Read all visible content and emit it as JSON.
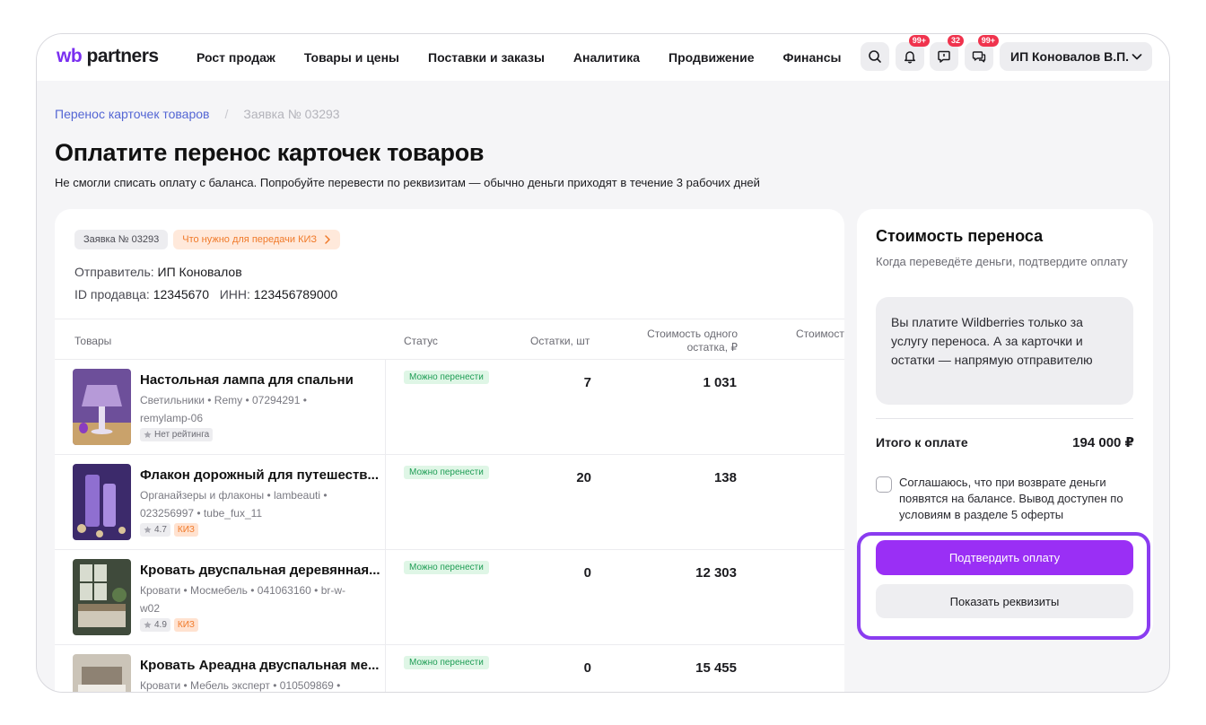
{
  "logo": {
    "wb": "wb",
    "partners": "partners"
  },
  "nav": [
    "Рост продаж",
    "Товары и цены",
    "Поставки и заказы",
    "Аналитика",
    "Продвижение",
    "Финансы"
  ],
  "header_icons": {
    "notifications_badge": "99+",
    "feedback_badge": "32",
    "chat_badge": "99+"
  },
  "account": {
    "name": "ИП Коновалов В.П."
  },
  "breadcrumb": {
    "parent": "Перенос карточек товаров",
    "separator": "/",
    "current": "Заявка № 03293"
  },
  "page": {
    "title": "Оплатите перенос карточек товаров",
    "subtitle": "Не смогли списать оплату с баланса. Попробуйте перевести по реквизитам — обычно деньги приходят в течение 3 рабочих дней"
  },
  "request": {
    "number_tag": "Заявка № 03293",
    "kiz_link": "Что нужно для передачи КИЗ",
    "sender_label": "Отправитель:",
    "sender_value": "ИП Коновалов",
    "seller_id_label": "ID продавца:",
    "seller_id_value": "12345670",
    "inn_label": "ИНН:",
    "inn_value": "123456789000"
  },
  "table": {
    "headers": {
      "goods": "Товары",
      "status": "Статус",
      "stock": "Остатки, шт",
      "unit_cost": "Стоимость одного остатка, ₽",
      "total_cost": "Стоимость остатков"
    },
    "rows": [
      {
        "name": "Настольная лампа для спальни",
        "meta": "Светильники • Remy • 07294291 • remylamp-06",
        "rating": "Нет рейтинга",
        "kiz": "",
        "status": "Можно перенести",
        "qty": "7",
        "price": "1 031"
      },
      {
        "name": "Флакон дорожный для путешеств...",
        "meta": "Органайзеры и флаконы • lambeauti • 023256997 • tube_fux_11",
        "rating": "4.7",
        "kiz": "КИЗ",
        "status": "Можно перенести",
        "qty": "20",
        "price": "138"
      },
      {
        "name": "Кровать двуспальная деревянная...",
        "meta": "Кровати • Мосмебель • 041063160 • br-w-w02",
        "rating": "4.9",
        "kiz": "КИЗ",
        "status": "Можно перенести",
        "qty": "0",
        "price": "12 303"
      },
      {
        "name": "Кровать Ареадна двуспальная ме...",
        "meta": "Кровати • Мебель эксперт • 010509869 •",
        "rating": "",
        "kiz": "",
        "status": "Можно перенести",
        "qty": "0",
        "price": "15 455"
      }
    ]
  },
  "summary": {
    "title": "Стоимость переноса",
    "subtitle": "Когда переведёте деньги, подтвердите оплату",
    "info": "Вы платите Wildberries только за услугу переноса. А за карточки и остатки — напрямую отправителю",
    "total_label": "Итого к оплате",
    "total_value": "194 000 ₽",
    "agree_text": "Соглашаюсь, что при возврате деньги появятся на балансе. Вывод доступен по условиям в разделе 5 оферты",
    "confirm_button": "Подтвердить оплату",
    "details_button": "Показать реквизиты"
  },
  "colors": {
    "accent": "#9a2ff5",
    "highlight": "#8a3cf0",
    "badge": "#f0334d",
    "status_green": "#1f9d55",
    "kiz_orange": "#f07a2a"
  }
}
